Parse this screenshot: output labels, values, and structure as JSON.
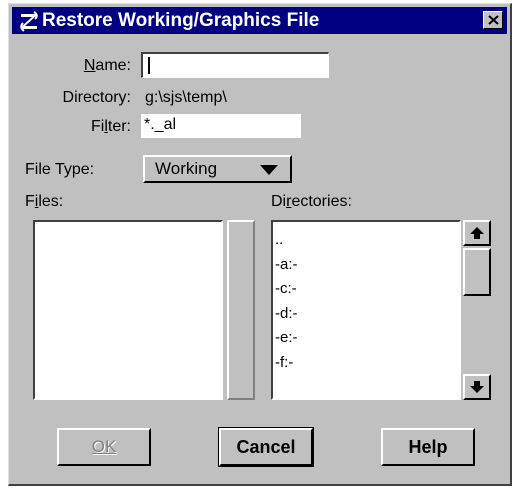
{
  "window": {
    "title": "Restore Working/Graphics File",
    "icon": "app-logo-icon",
    "close_icon": "close-icon"
  },
  "form": {
    "name_label": "Name:",
    "name_value": "",
    "directory_label": "Directory:",
    "directory_value": "g:\\sjs\\temp\\",
    "filter_label": "Filter:",
    "filter_value": "*._al",
    "file_type_label": "File Type:",
    "file_type_value": "Working"
  },
  "files": {
    "label": "Files:",
    "items": []
  },
  "directories": {
    "label": "Directories:",
    "items": [
      "..",
      "-a:-",
      "-c:-",
      "-d:-",
      "-e:-",
      "-f:-"
    ]
  },
  "buttons": {
    "ok": "OK",
    "cancel": "Cancel",
    "help": "Help"
  },
  "colors": {
    "title_bar": "#000080",
    "dialog_face": "#c0c0c0",
    "field_bg": "#ffffff",
    "disabled_text": "#808080"
  }
}
